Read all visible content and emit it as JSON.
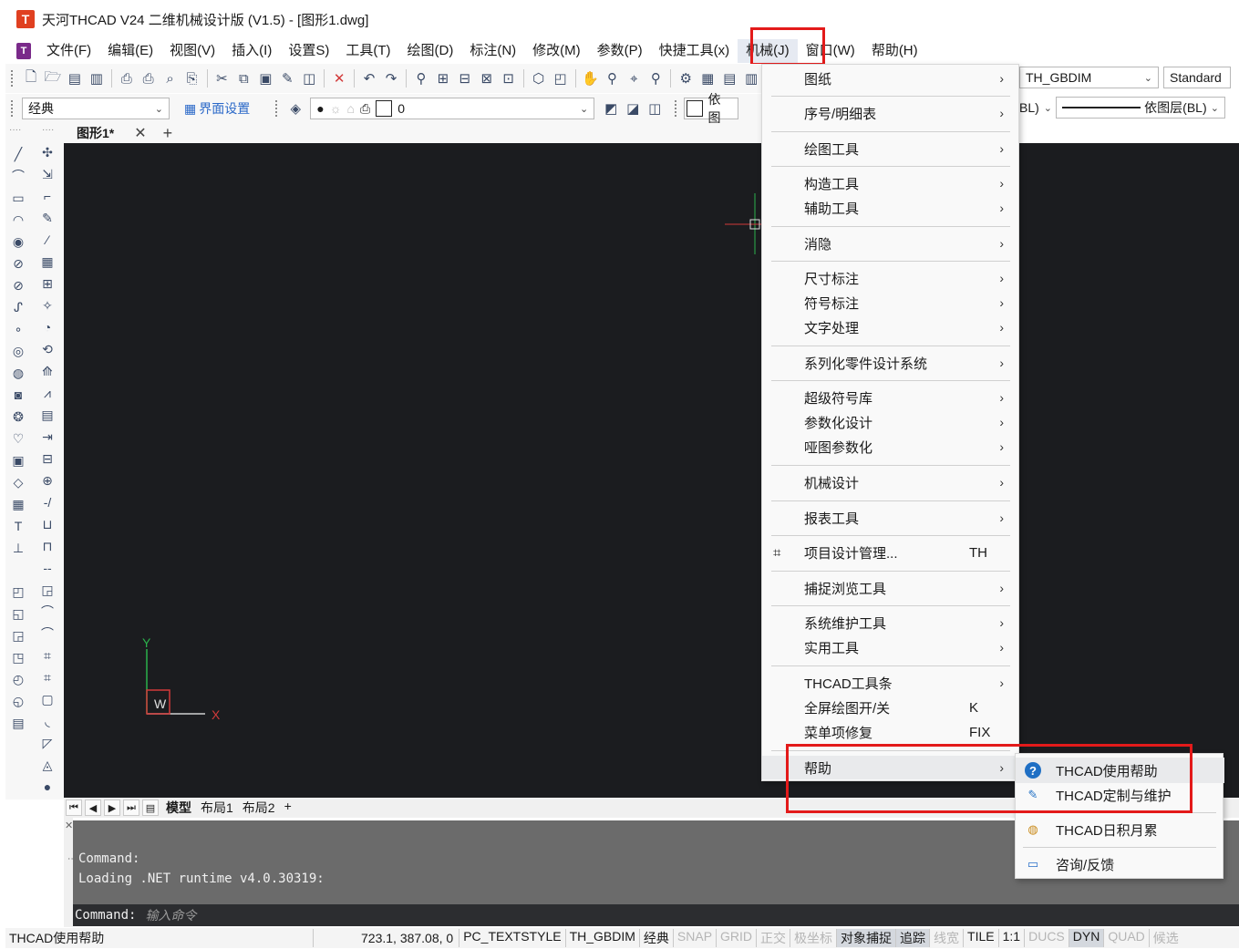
{
  "window": {
    "logo_letter": "T",
    "title": "天河THCAD V24 二维机械设计版 (V1.5) - [图形1.dwg]"
  },
  "menubar": {
    "items": [
      "文件(F)",
      "编辑(E)",
      "视图(V)",
      "插入(I)",
      "设置S)",
      "工具(T)",
      "绘图(D)",
      "标注(N)",
      "修改(M)",
      "参数(P)",
      "快捷工具(x)",
      "机械(J)",
      "窗口(W)",
      "帮助(H)"
    ],
    "active": "机械(J)"
  },
  "toolbar2": {
    "workspace": "经典",
    "ui_settings": "界面设置",
    "layer_value": "0",
    "dim_style": "TH_GBDIM",
    "text_style": "Standard",
    "color_label": "依图",
    "bylayer_short": "BL)",
    "linetype_label": "依图层(BL)"
  },
  "tabs": {
    "document": "图形1*"
  },
  "dropdown": {
    "items": [
      {
        "label": "图纸",
        "arrow": true
      },
      {
        "label": "序号/明细表",
        "arrow": true
      },
      {
        "label": "绘图工具",
        "arrow": true
      },
      {
        "label": "构造工具",
        "arrow": true
      },
      {
        "label": "辅助工具",
        "arrow": true
      },
      {
        "label": "消隐",
        "arrow": true
      },
      {
        "label": "尺寸标注",
        "arrow": true
      },
      {
        "label": "符号标注",
        "arrow": true
      },
      {
        "label": "文字处理",
        "arrow": true
      },
      {
        "label": "系列化零件设计系统",
        "arrow": true
      },
      {
        "label": "超级符号库",
        "arrow": true
      },
      {
        "label": "参数化设计",
        "arrow": true
      },
      {
        "label": "哑图参数化",
        "arrow": true
      },
      {
        "label": "机械设计",
        "arrow": true
      },
      {
        "label": "报表工具",
        "arrow": true
      },
      {
        "label": "项目设计管理...",
        "shortcut": "TH"
      },
      {
        "label": "捕捉浏览工具",
        "arrow": true
      },
      {
        "label": "系统维护工具",
        "arrow": true
      },
      {
        "label": "实用工具",
        "arrow": true
      },
      {
        "label": "THCAD工具条",
        "arrow": true
      },
      {
        "label": "全屏绘图开/关",
        "shortcut": "K"
      },
      {
        "label": "菜单项修复",
        "shortcut": "FIX"
      },
      {
        "label": "帮助",
        "arrow": true
      }
    ]
  },
  "submenu": {
    "items": [
      {
        "label": "THCAD使用帮助",
        "icon": "help-icon"
      },
      {
        "label": "THCAD定制与维护",
        "icon": "wrench-icon"
      },
      {
        "label": "THCAD日积月累",
        "icon": "globe-icon"
      },
      {
        "label": "咨询/反馈",
        "icon": "monitor-icon"
      }
    ]
  },
  "canvas": {
    "ucs_y": "Y",
    "ucs_x": "X",
    "ucs_w": "W"
  },
  "layout_tabs": [
    "模型",
    "布局1",
    "布局2",
    "+"
  ],
  "command": {
    "history": [
      "Command:",
      "Loading .NET runtime v4.0.30319:"
    ],
    "prompt": "Command:",
    "placeholder": "输入命令"
  },
  "status": {
    "message": "THCAD使用帮助",
    "coords": "723.1, 387.08, 0",
    "items": [
      {
        "label": "PC_TEXTSTYLE",
        "state": "normal"
      },
      {
        "label": "TH_GBDIM",
        "state": "normal"
      },
      {
        "label": "经典",
        "state": "normal"
      },
      {
        "label": "SNAP",
        "state": "off"
      },
      {
        "label": "GRID",
        "state": "off"
      },
      {
        "label": "正交",
        "state": "off"
      },
      {
        "label": "极坐标",
        "state": "off"
      },
      {
        "label": "对象捕捉",
        "state": "on"
      },
      {
        "label": "追踪",
        "state": "on"
      },
      {
        "label": "线宽",
        "state": "off"
      },
      {
        "label": "TILE",
        "state": "normal"
      },
      {
        "label": "1:1",
        "state": "normal"
      },
      {
        "label": "DUCS",
        "state": "off"
      },
      {
        "label": "DYN",
        "state": "on"
      },
      {
        "label": "QUAD",
        "state": "off"
      },
      {
        "label": "候选",
        "state": "off"
      }
    ]
  },
  "colors": {
    "highlight": "#e31a1a",
    "canvas": "#1b1c1f",
    "ucs_y": "#2bb24c",
    "ucs_x": "#d23a3a"
  }
}
